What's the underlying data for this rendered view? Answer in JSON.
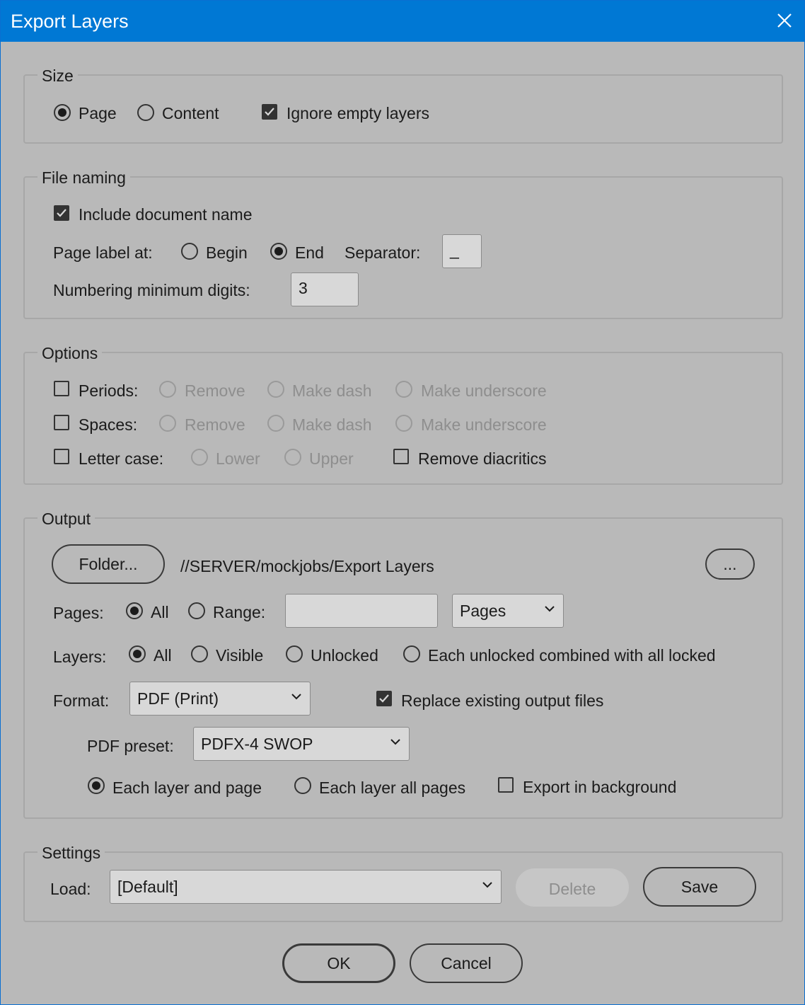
{
  "window": {
    "title": "Export Layers"
  },
  "size": {
    "legend": "Size",
    "page_label": "Page",
    "content_label": "Content",
    "ignore_empty_label": "Ignore empty layers"
  },
  "file_naming": {
    "legend": "File naming",
    "include_doc_name_label": "Include document name",
    "page_label_at": "Page label at:",
    "begin_label": "Begin",
    "end_label": "End",
    "separator_label": "Separator:",
    "separator_value": "_",
    "min_digits_label": "Numbering minimum digits:",
    "min_digits_value": "3"
  },
  "options": {
    "legend": "Options",
    "periods_label": "Periods:",
    "spaces_label": "Spaces:",
    "remove_label": "Remove",
    "make_dash_label": "Make dash",
    "make_underscore_label": "Make underscore",
    "letter_case_label": "Letter case:",
    "lower_label": "Lower",
    "upper_label": "Upper",
    "remove_diacritics_label": "Remove diacritics"
  },
  "output": {
    "legend": "Output",
    "folder_button": "Folder...",
    "folder_path": "//SERVER/mockjobs/Export Layers",
    "more_button": "...",
    "pages_label": "Pages:",
    "all_label": "All",
    "range_label": "Range:",
    "range_value": "",
    "range_unit": "Pages",
    "layers_label": "Layers:",
    "visible_label": "Visible",
    "unlocked_label": "Unlocked",
    "each_unlocked_label": "Each unlocked combined with all locked",
    "format_label": "Format:",
    "format_value": "PDF (Print)",
    "replace_label": "Replace existing output files",
    "pdf_preset_label": "PDF preset:",
    "pdf_preset_value": "PDFX-4 SWOP",
    "each_layer_page_label": "Each layer and page",
    "each_layer_all_pages_label": "Each layer all pages",
    "export_background_label": "Export in background"
  },
  "settings": {
    "legend": "Settings",
    "load_label": "Load:",
    "load_value": "[Default]",
    "delete_button": "Delete",
    "save_button": "Save"
  },
  "footer": {
    "ok_button": "OK",
    "cancel_button": "Cancel"
  },
  "colors": {
    "titlebar": "#0078d4",
    "background": "#b9b9b9"
  },
  "icons": {
    "close": "close-icon",
    "chevron": "chevron-down-icon",
    "check": "check-icon"
  }
}
